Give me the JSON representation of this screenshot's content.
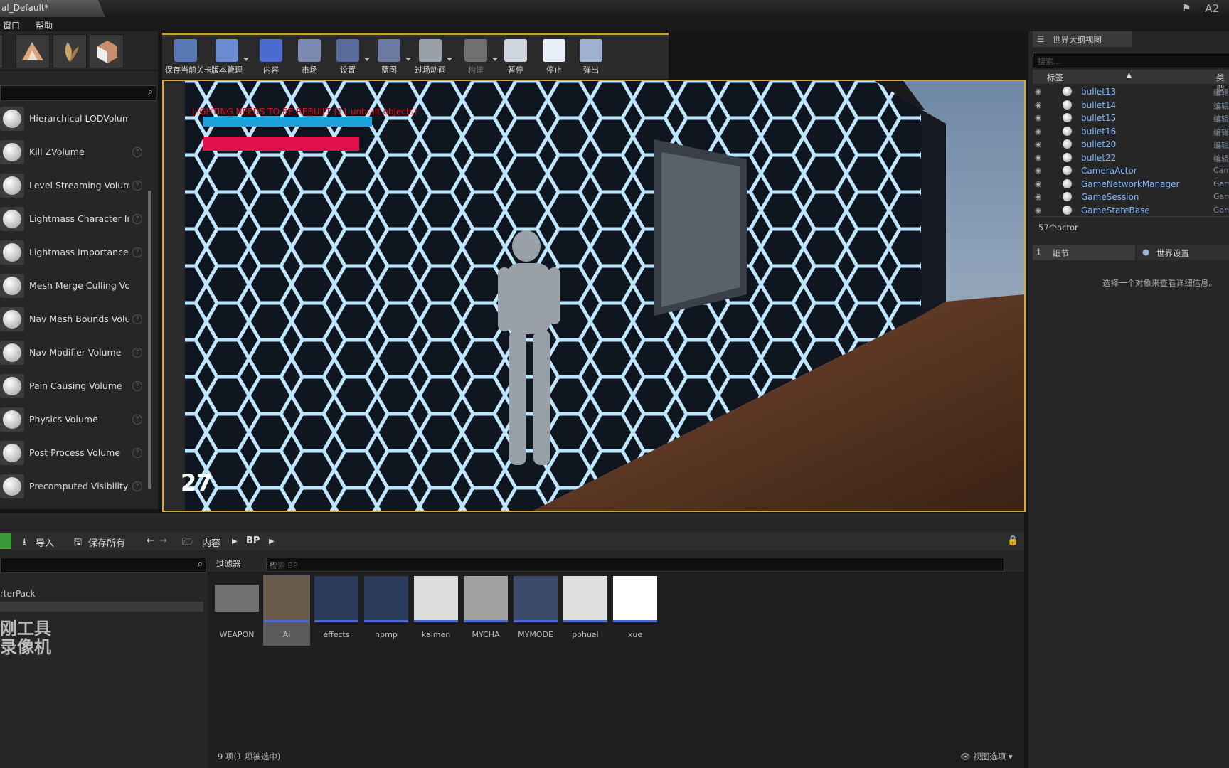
{
  "window": {
    "title_tab": "al_Default*",
    "right_label": "A2"
  },
  "menu": {
    "items": [
      "窗口",
      "帮助"
    ]
  },
  "placement": {
    "volumes": [
      {
        "label": "Hierarchical LODVolume",
        "help": false
      },
      {
        "label": "Kill ZVolume",
        "help": true
      },
      {
        "label": "Level Streaming Volume",
        "help": true
      },
      {
        "label": "Lightmass Character Inc",
        "help": true
      },
      {
        "label": "Lightmass Importance V",
        "help": true
      },
      {
        "label": "Mesh Merge Culling Volume",
        "help": false
      },
      {
        "label": "Nav Mesh Bounds Volun",
        "help": true
      },
      {
        "label": "Nav Modifier Volume",
        "help": true
      },
      {
        "label": "Pain Causing Volume",
        "help": true
      },
      {
        "label": "Physics Volume",
        "help": true
      },
      {
        "label": "Post Process Volume",
        "help": true
      },
      {
        "label": "Precomputed Visibility C",
        "help": true
      }
    ]
  },
  "toolbar": {
    "buttons": [
      {
        "label": "保存当前关卡",
        "icon": "save-icon",
        "dropdown": false
      },
      {
        "label": "版本管理",
        "icon": "source-control-icon",
        "dropdown": true
      },
      {
        "label": "内容",
        "icon": "content-icon",
        "dropdown": false
      },
      {
        "label": "市场",
        "icon": "marketplace-icon",
        "dropdown": false
      },
      {
        "label": "设置",
        "icon": "settings-icon",
        "dropdown": true
      },
      {
        "label": "蓝图",
        "icon": "blueprint-icon",
        "dropdown": true
      },
      {
        "label": "过场动画",
        "icon": "cinematics-icon",
        "dropdown": true
      },
      {
        "label": "构建",
        "icon": "build-icon",
        "dropdown": true
      },
      {
        "label": "暂停",
        "icon": "pause-icon",
        "dropdown": false
      },
      {
        "label": "停止",
        "icon": "stop-icon",
        "dropdown": false
      },
      {
        "label": "弹出",
        "icon": "eject-icon",
        "dropdown": false
      }
    ]
  },
  "viewport": {
    "warning": "LIGHTING NEEDS TO BE REBUILT (11 unbuilt objects)",
    "counter": "27",
    "health_fraction": 1.0,
    "ammo_fraction": 1.0
  },
  "outliner": {
    "tab_label": "世界大纲视图",
    "search_placeholder": "搜索...",
    "col_label": "标签",
    "col_type": "类型",
    "rows": [
      {
        "name": "bullet13",
        "type": "编辑"
      },
      {
        "name": "bullet14",
        "type": "编辑"
      },
      {
        "name": "bullet15",
        "type": "编辑"
      },
      {
        "name": "bullet16",
        "type": "编辑"
      },
      {
        "name": "bullet20",
        "type": "编辑"
      },
      {
        "name": "bullet22",
        "type": "编辑"
      },
      {
        "name": "CameraActor",
        "type": "Cam"
      },
      {
        "name": "GameNetworkManager",
        "type": "Gam"
      },
      {
        "name": "GameSession",
        "type": "Gam"
      },
      {
        "name": "GameStateBase",
        "type": "Gam"
      }
    ],
    "actor_count": "57个actor"
  },
  "details": {
    "tab_label": "细节",
    "world_tab_label": "世界设置",
    "empty_message": "选择一个对象来查看详细信息。"
  },
  "content_browser": {
    "import_label": "导入",
    "save_all_label": "保存所有",
    "path": [
      "内容",
      "BP"
    ],
    "filter_label": "过滤器",
    "search_placeholder": "搜索 BP",
    "folder_name": "rterPack",
    "watermark_line1": "刚工具",
    "watermark_line2": "录像机",
    "assets": [
      "WEAPON",
      "AI",
      "effects",
      "hpmp",
      "kaimen",
      "MYCHA",
      "MYMODE",
      "pohuai",
      "xue"
    ],
    "item_count": "9 项(1 项被选中)",
    "view_options": "视图选项"
  }
}
